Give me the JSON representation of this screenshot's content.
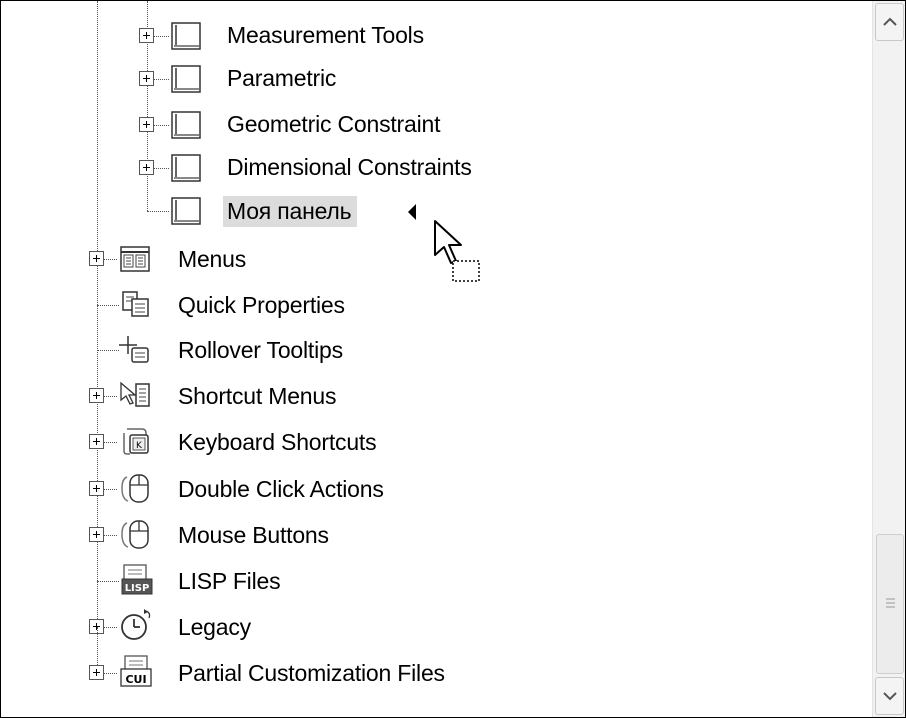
{
  "tree": {
    "panels": [
      {
        "label": "Measurement Tools"
      },
      {
        "label": "Parametric"
      },
      {
        "label": "Geometric Constraint"
      },
      {
        "label": "Dimensional Constraints"
      }
    ],
    "new_panel": {
      "label": "Моя панель"
    },
    "nodes": [
      {
        "label": "Menus",
        "icon": "menus-icon"
      },
      {
        "label": "Quick Properties",
        "icon": "quick-properties-icon"
      },
      {
        "label": "Rollover Tooltips",
        "icon": "rollover-tooltips-icon"
      },
      {
        "label": "Shortcut Menus",
        "icon": "shortcut-menus-icon"
      },
      {
        "label": "Keyboard Shortcuts",
        "icon": "keyboard-icon"
      },
      {
        "label": "Double Click Actions",
        "icon": "mouse-icon"
      },
      {
        "label": "Mouse Buttons",
        "icon": "mouse-icon"
      },
      {
        "label": "LISP Files",
        "icon": "lisp-icon"
      },
      {
        "label": "Legacy",
        "icon": "clock-icon"
      },
      {
        "label": "Partial Customization Files",
        "icon": "cui-icon"
      }
    ],
    "icon_texts": {
      "lisp": "LISP",
      "cui": "CUI"
    }
  },
  "scrollbar": {
    "up": "scroll-up-icon",
    "down": "scroll-down-icon",
    "grip": "grip-icon"
  }
}
